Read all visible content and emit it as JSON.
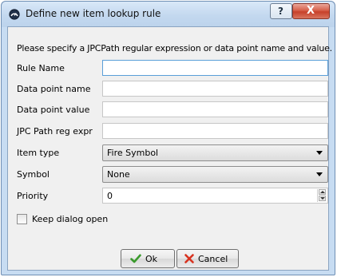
{
  "window": {
    "title": "Define new item lookup rule",
    "help_glyph": "?",
    "close_glyph": "X"
  },
  "form": {
    "instructions": "Please specify a JPCPath regular expression or data point name and value.",
    "rule_name": {
      "label": "Rule Name",
      "value": ""
    },
    "data_point_name": {
      "label": "Data point name",
      "value": ""
    },
    "data_point_value": {
      "label": "Data point value",
      "value": ""
    },
    "jpc_path": {
      "label": "JPC Path reg expr",
      "value": ""
    },
    "item_type": {
      "label": "Item type",
      "selected": "Fire Symbol"
    },
    "symbol": {
      "label": "Symbol",
      "selected": "None"
    },
    "priority": {
      "label": "Priority",
      "value": "0"
    },
    "keep_open": {
      "label": "Keep dialog open",
      "checked": false
    }
  },
  "buttons": {
    "ok_label": "Ok",
    "cancel_label": "Cancel"
  },
  "icons": {
    "app": "gauge-icon",
    "ok": "checkmark-icon",
    "cancel": "red-x-icon"
  },
  "colors": {
    "close_red": "#c7402a",
    "ok_green": "#3a9a2c",
    "cancel_red": "#d8321f",
    "focus_blue": "#5a9fd8"
  }
}
